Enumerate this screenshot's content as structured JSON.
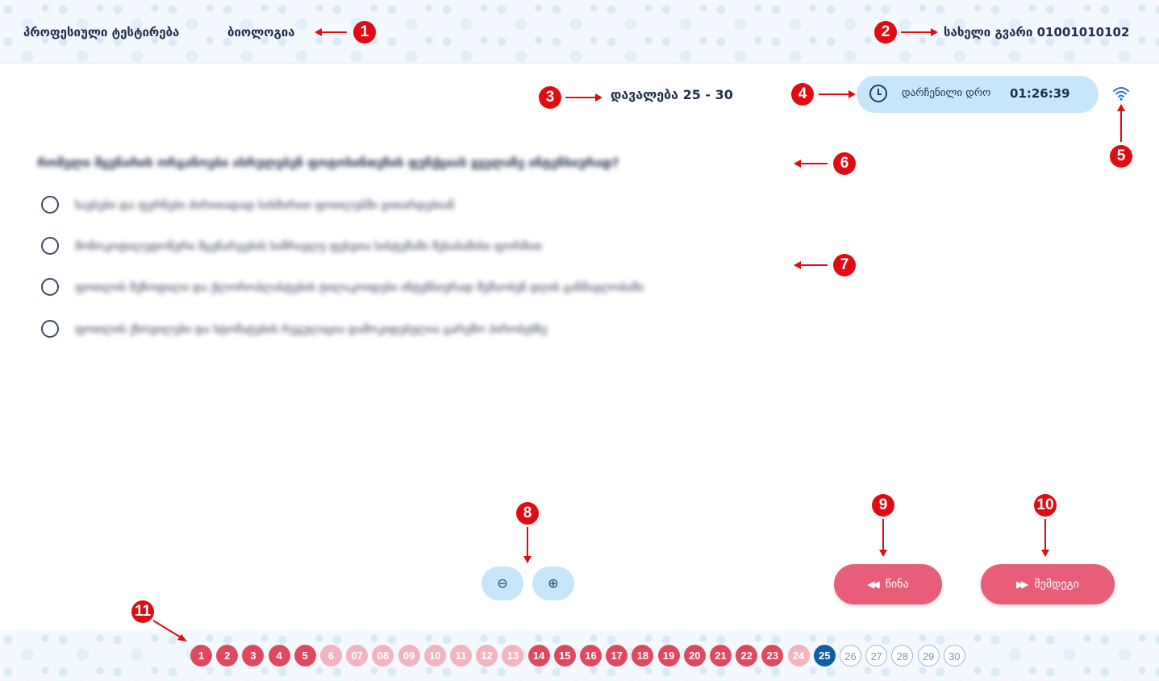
{
  "header": {
    "exam_title": "პროფესიული ტესტირება",
    "subject": "ბიოლოგია",
    "user": "სახელი გვარი 01001010102"
  },
  "task": {
    "label": "დავალება",
    "current": "25",
    "separator": "-",
    "total": "30"
  },
  "timer": {
    "label": "დარჩენილი დრო",
    "value": "01:26:39",
    "icon": "clock-icon"
  },
  "connection": {
    "icon": "wifi-icon"
  },
  "question": {
    "text": "რომელი მცენარის ორგანოები ასრულებენ ფოტოსინთეზის ფუნქციას ყველაზე ინტენსიურად?",
    "options": [
      "ხავსები და ფერნები ძირითადად სიხშირით ფოთლებში ვითარდებიან",
      "მონოკოტილედონური მცენარეების სიმრავლე ფესვთა სისტემაში შესაბამისი ფორმით",
      "ფოთლის მეზოფილი და ქლოროპლასტების ტილაკოიდები ინტენსიურად მუშაობენ დღის განმავლობაში",
      "ფოთლის ქსოვილები და სტომატების რეგულაცია დამოკიდებულია გარემო პირობებზე"
    ]
  },
  "zoom": {
    "minus_symbol": "⊖",
    "plus_symbol": "⊕"
  },
  "navigation": {
    "prev_label": "წინა",
    "next_label": "შემდეგი",
    "prev_icon": "rewind-icon",
    "next_icon": "fast-forward-icon"
  },
  "pager": {
    "pages": [
      {
        "label": "1",
        "state": "answered"
      },
      {
        "label": "2",
        "state": "answered"
      },
      {
        "label": "3",
        "state": "answered"
      },
      {
        "label": "4",
        "state": "answered"
      },
      {
        "label": "5",
        "state": "answered"
      },
      {
        "label": "6",
        "state": "skipped"
      },
      {
        "label": "07",
        "state": "skipped"
      },
      {
        "label": "08",
        "state": "skipped"
      },
      {
        "label": "09",
        "state": "skipped"
      },
      {
        "label": "10",
        "state": "skipped"
      },
      {
        "label": "11",
        "state": "skipped"
      },
      {
        "label": "12",
        "state": "skipped"
      },
      {
        "label": "13",
        "state": "skipped"
      },
      {
        "label": "14",
        "state": "answered"
      },
      {
        "label": "15",
        "state": "answered"
      },
      {
        "label": "16",
        "state": "answered"
      },
      {
        "label": "17",
        "state": "answered"
      },
      {
        "label": "18",
        "state": "answered"
      },
      {
        "label": "19",
        "state": "answered"
      },
      {
        "label": "20",
        "state": "answered"
      },
      {
        "label": "21",
        "state": "answered"
      },
      {
        "label": "22",
        "state": "answered"
      },
      {
        "label": "23",
        "state": "answered"
      },
      {
        "label": "24",
        "state": "skipped"
      },
      {
        "label": "25",
        "state": "current"
      },
      {
        "label": "26",
        "state": "pending"
      },
      {
        "label": "27",
        "state": "pending"
      },
      {
        "label": "28",
        "state": "pending"
      },
      {
        "label": "29",
        "state": "pending"
      },
      {
        "label": "30",
        "state": "pending"
      }
    ]
  },
  "callouts": [
    "1",
    "2",
    "3",
    "4",
    "5",
    "6",
    "7",
    "8",
    "9",
    "10",
    "11"
  ],
  "colors": {
    "accent_red": "#e85e78",
    "answered": "#e0485f",
    "skipped": "#f3b3bf",
    "current": "#0e5fa8",
    "timer_bg": "#c7e6fa",
    "callout": "#e10b12"
  }
}
